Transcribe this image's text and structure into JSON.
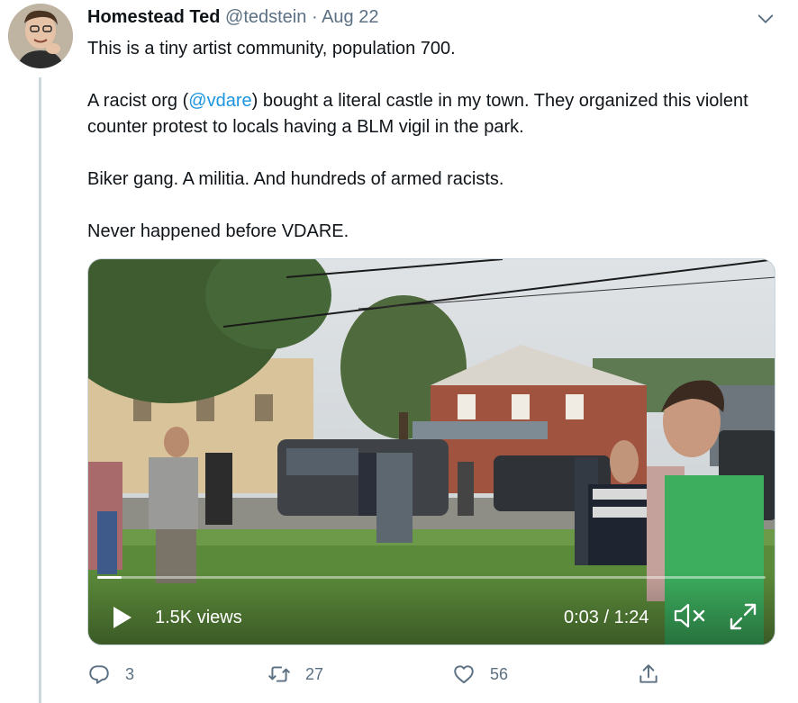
{
  "tweet": {
    "author": {
      "name": "Homestead Ted",
      "handle": "@tedstein",
      "separator": "·",
      "date": "Aug 22"
    },
    "text": {
      "line1": "This is a tiny artist community, population 700.",
      "para2_before": "A racist org (",
      "para2_mention": "@vdare",
      "para2_after": ") bought a literal castle in my town. They organized this violent counter protest to locals having a BLM vigil in the park.",
      "para3": "Biker gang. A militia. And hundreds of armed racists.",
      "para4": "Never happened before VDARE."
    },
    "video": {
      "views": "1.5K views",
      "time": "0:03 / 1:24",
      "progress_fraction": 0.036
    },
    "actions": {
      "reply_count": "3",
      "retweet_count": "27",
      "like_count": "56"
    },
    "icons": [
      "avatar",
      "chevron-down-icon",
      "play-icon",
      "mute-icon",
      "fullscreen-icon",
      "reply-icon",
      "retweet-icon",
      "like-icon",
      "share-icon"
    ],
    "colors": {
      "link": "#1b95e0",
      "secondary_text": "#5b7083",
      "thread_line": "#ccd6dd"
    }
  }
}
